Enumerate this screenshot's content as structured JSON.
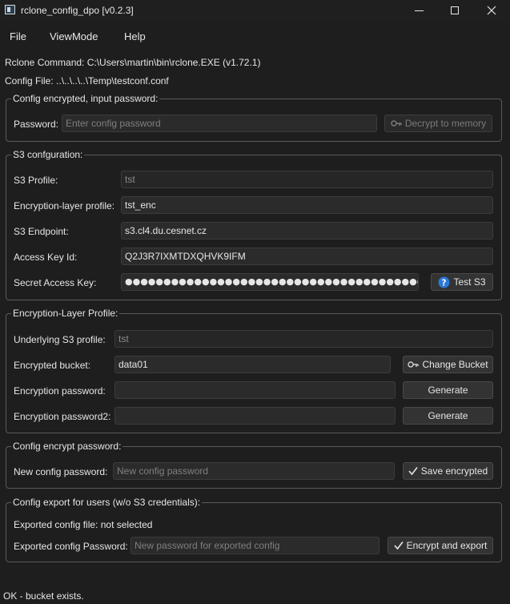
{
  "window": {
    "title": "rclone_config_dpo [v0.2.3]"
  },
  "menu": [
    "File",
    "ViewMode",
    "Help"
  ],
  "info": {
    "rclone_command": "Rclone Command: C:\\Users\\martin\\bin\\rclone.EXE (v1.72.1)",
    "config_file": "Config File: ..\\..\\..\\..\\Temp\\testconf.conf"
  },
  "encrypted_group": {
    "title": "Config encrypted, input password:",
    "password_label": "Password:",
    "password_placeholder": "Enter config password",
    "decrypt_button": "Decrypt to memory"
  },
  "s3_group": {
    "title": "S3 confguration:",
    "profile_label": "S3 Profile:",
    "profile_value": "tst",
    "enc_profile_label": "Encryption-layer profile:",
    "enc_profile_value": "tst_enc",
    "endpoint_label": "S3 Endpoint:",
    "endpoint_value": "s3.cl4.du.cesnet.cz",
    "access_key_label": "Access Key Id:",
    "access_key_value": "Q2J3R7IXMTDXQHVK9IFM",
    "secret_label": "Secret Access Key:",
    "secret_value": "●●●●●●●●●●●●●●●●●●●●●●●●●●●●●●●●●●●●●●●●",
    "test_button": "Test S3"
  },
  "enc_layer_group": {
    "title": "Encryption-Layer Profile:",
    "underlying_label": "Underlying S3 profile:",
    "underlying_value": "tst",
    "bucket_label": "Encrypted bucket:",
    "bucket_value": "data01",
    "change_bucket_button": "Change Bucket",
    "pw1_label": "Encryption password:",
    "pw1_value": "",
    "generate1_button": "Generate",
    "pw2_label": "Encryption password2:",
    "pw2_value": "",
    "generate2_button": "Generate"
  },
  "config_encrypt_group": {
    "title": "Config encrypt password:",
    "new_pw_label": "New config password:",
    "new_pw_placeholder": "New config password",
    "save_button": "Save encrypted"
  },
  "export_group": {
    "title": "Config export for users (w/o S3 credentials):",
    "exported_file": "Exported config file: not selected",
    "export_pw_label": "Exported config Password:",
    "export_pw_placeholder": "New password for exported config",
    "export_button": "Encrypt and export"
  },
  "status": "OK - bucket exists.",
  "colors": {
    "background": "#1e1e1e",
    "input": "#2b2b2b",
    "border": "#5a5a5a",
    "help_icon": "#2a78d6"
  }
}
